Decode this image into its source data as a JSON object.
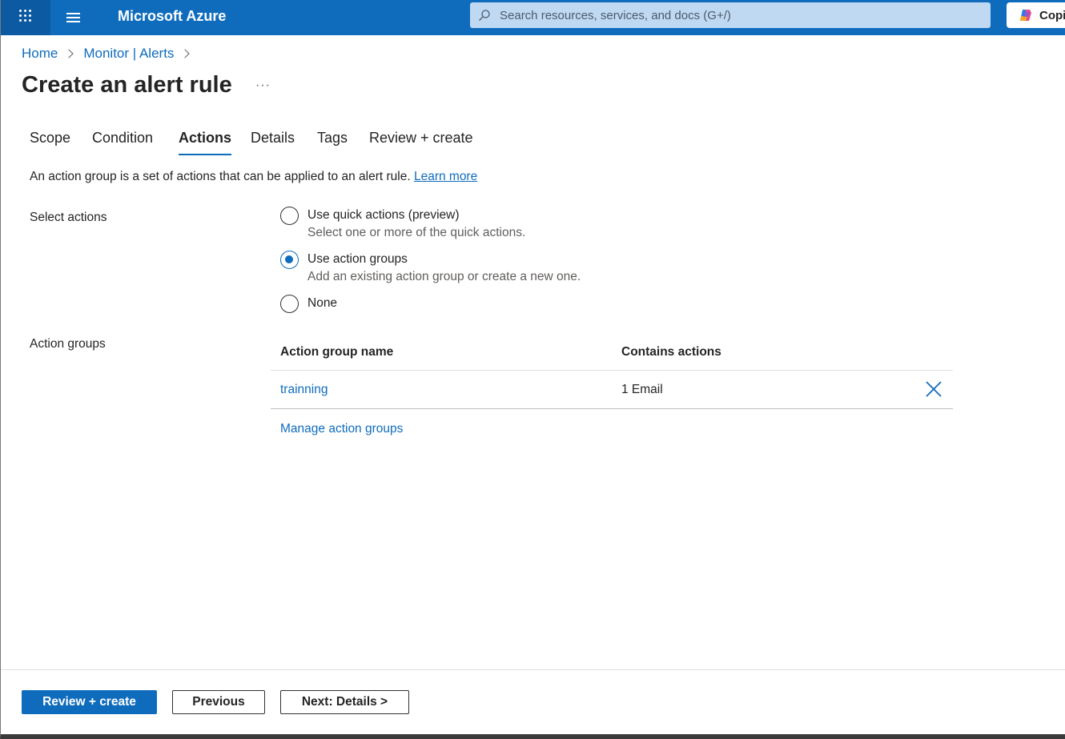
{
  "topbar": {
    "brand": "Microsoft Azure",
    "search_placeholder": "Search resources, services, and docs (G+/)",
    "copilot_label": "Copi"
  },
  "breadcrumb": [
    "Home",
    "Monitor | Alerts"
  ],
  "page": {
    "title": "Create an alert rule",
    "more": "···"
  },
  "tabs": [
    {
      "label": "Scope",
      "active": false
    },
    {
      "label": "Condition",
      "active": false
    },
    {
      "label": "Actions",
      "active": true
    },
    {
      "label": "Details",
      "active": false
    },
    {
      "label": "Tags",
      "active": false
    },
    {
      "label": "Review + create",
      "active": false
    }
  ],
  "intro": {
    "text": "An action group is a set of actions that can be applied to an alert rule.",
    "link": "Learn more"
  },
  "select_actions": {
    "label": "Select actions",
    "options": [
      {
        "label": "Use quick actions (preview)",
        "description": "Select one or more of the quick actions.",
        "selected": false
      },
      {
        "label": "Use action groups",
        "description": "Add an existing action group or create a new one.",
        "selected": true
      },
      {
        "label": "None",
        "description": "",
        "selected": false
      }
    ]
  },
  "action_groups": {
    "label": "Action groups",
    "columns": [
      "Action group name",
      "Contains actions"
    ],
    "rows": [
      {
        "name": "trainning",
        "actions": "1 Email"
      }
    ],
    "manage_link": "Manage action groups"
  },
  "footer": {
    "review_create": "Review + create",
    "previous": "Previous",
    "next": "Next: Details >"
  },
  "colors": {
    "accent": "#0f6cbd",
    "topbar": "#0f6cbd"
  }
}
